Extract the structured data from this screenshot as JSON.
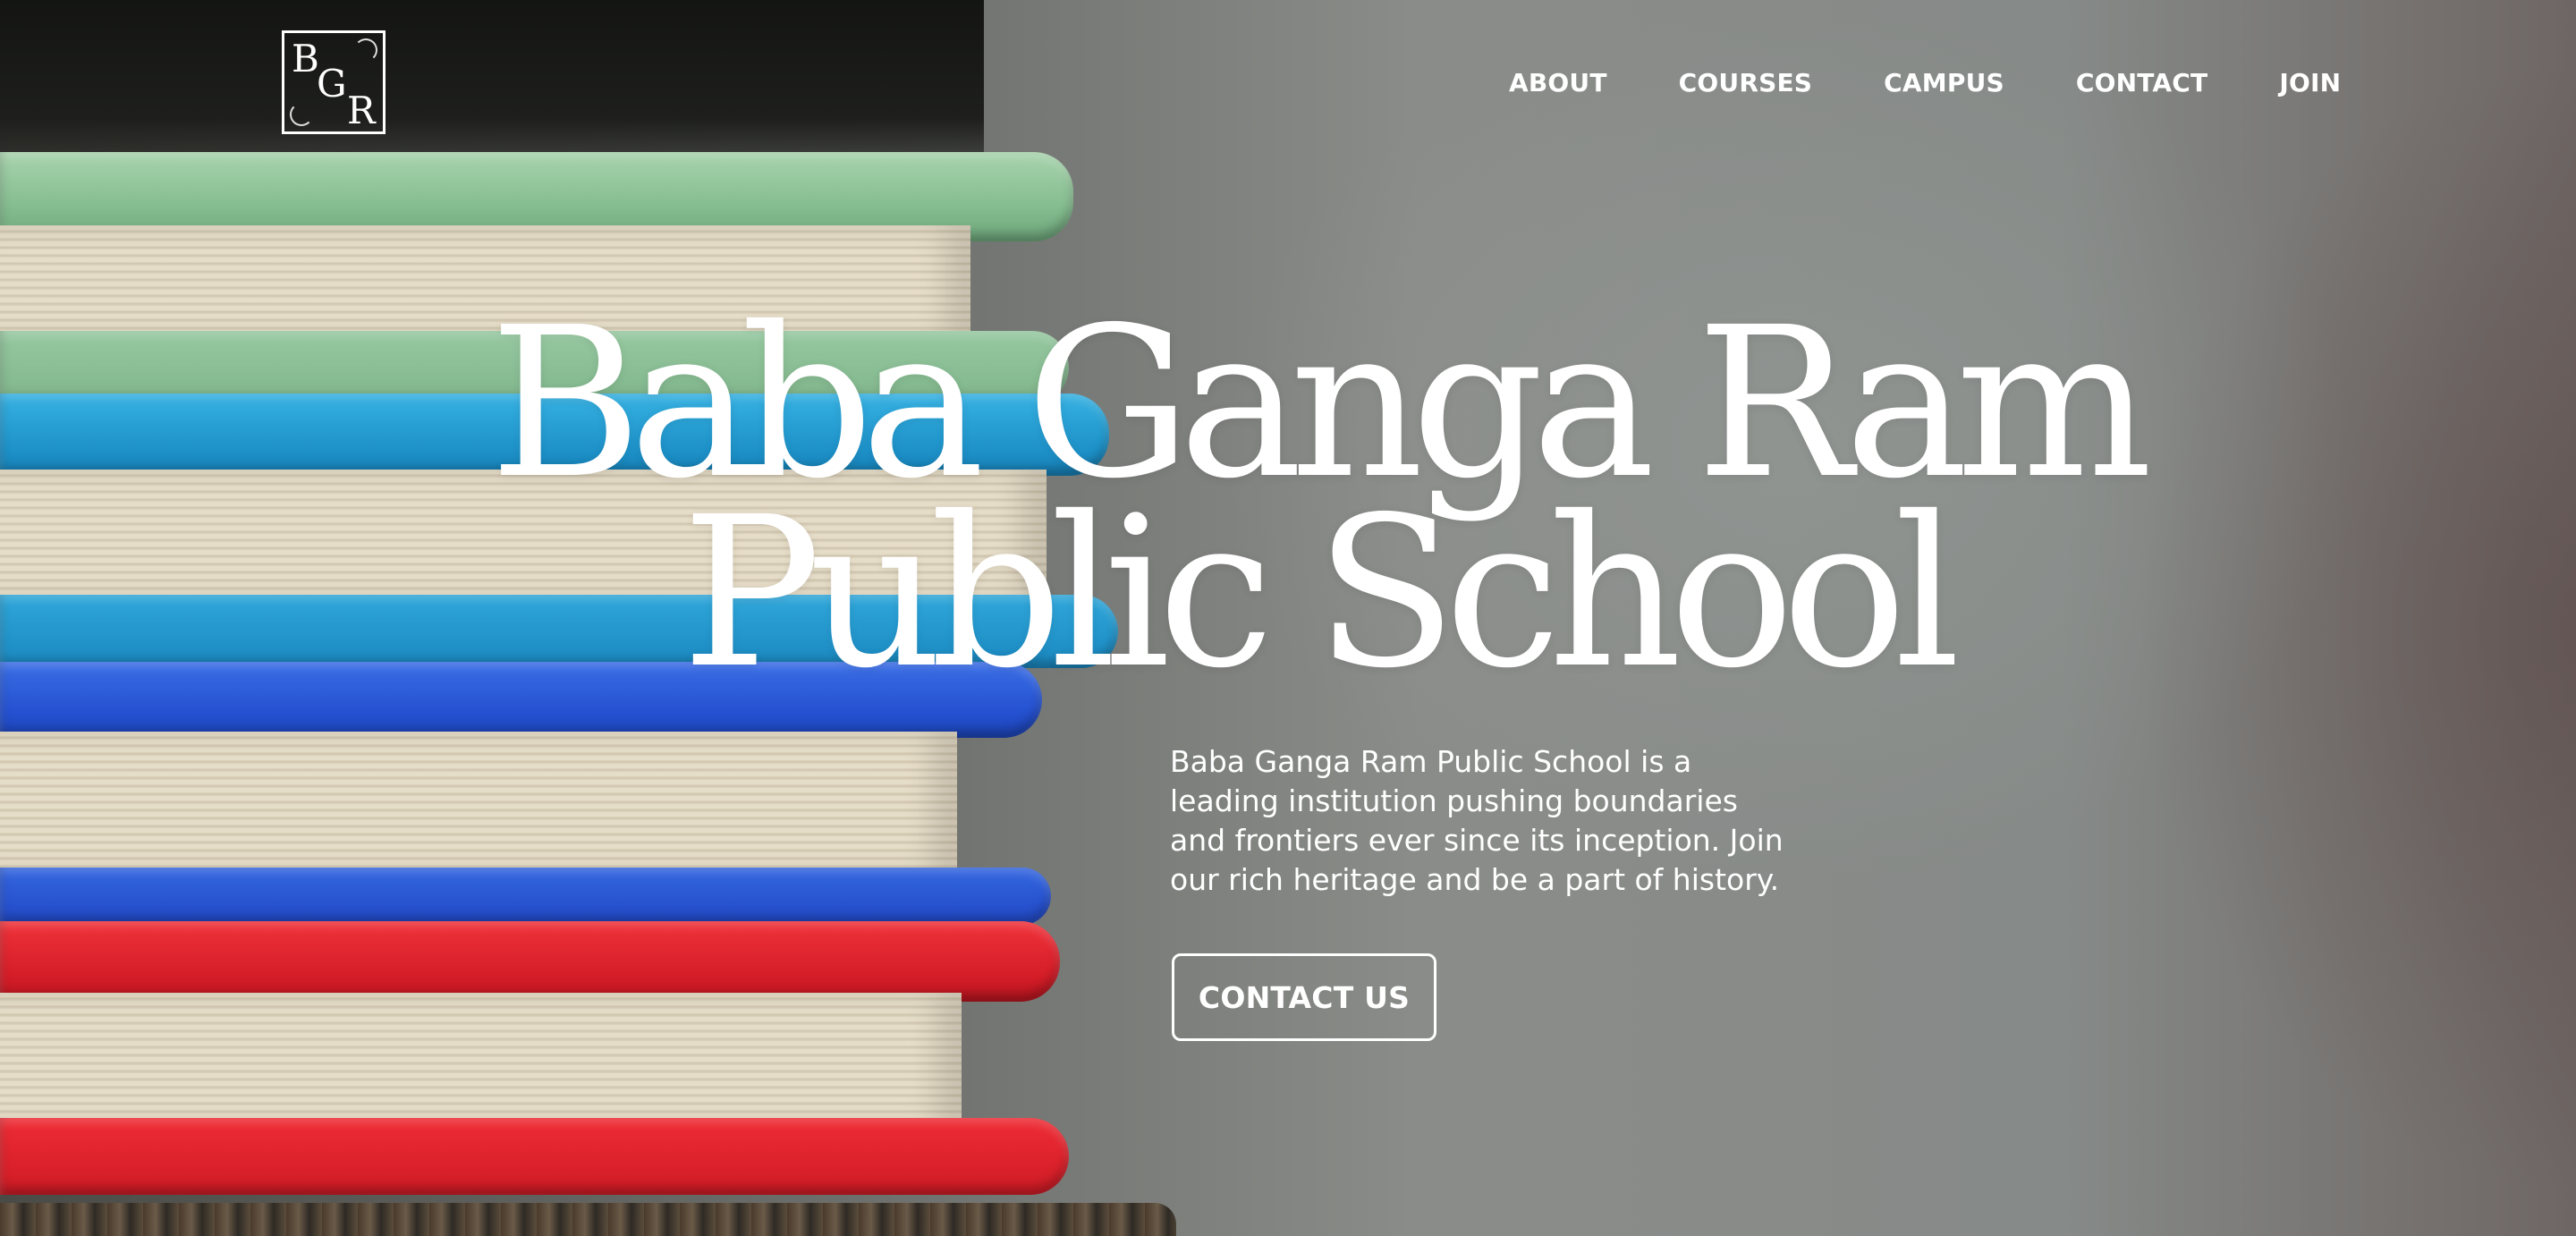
{
  "logo": {
    "letters": [
      "B",
      "G",
      "R"
    ]
  },
  "nav": {
    "items": [
      {
        "label": "ABOUT"
      },
      {
        "label": "COURSES"
      },
      {
        "label": "CAMPUS"
      },
      {
        "label": "CONTACT"
      },
      {
        "label": "JOIN"
      }
    ]
  },
  "hero": {
    "title_line1": "Baba Ganga Ram",
    "title_line2": "Public School",
    "description": "Baba Ganga Ram Public School is a leading institution pushing boundaries and frontiers ever since its inception. Join our rich heritage and be a part of history.",
    "cta_label": "CONTACT US"
  },
  "background": {
    "image": "stack-of-colorful-books",
    "colors": {
      "green": "#8fc49a",
      "teal": "#2aa3d6",
      "blue": "#2f5fdb",
      "red": "#e2252f",
      "backdrop": "#7f8180"
    }
  }
}
